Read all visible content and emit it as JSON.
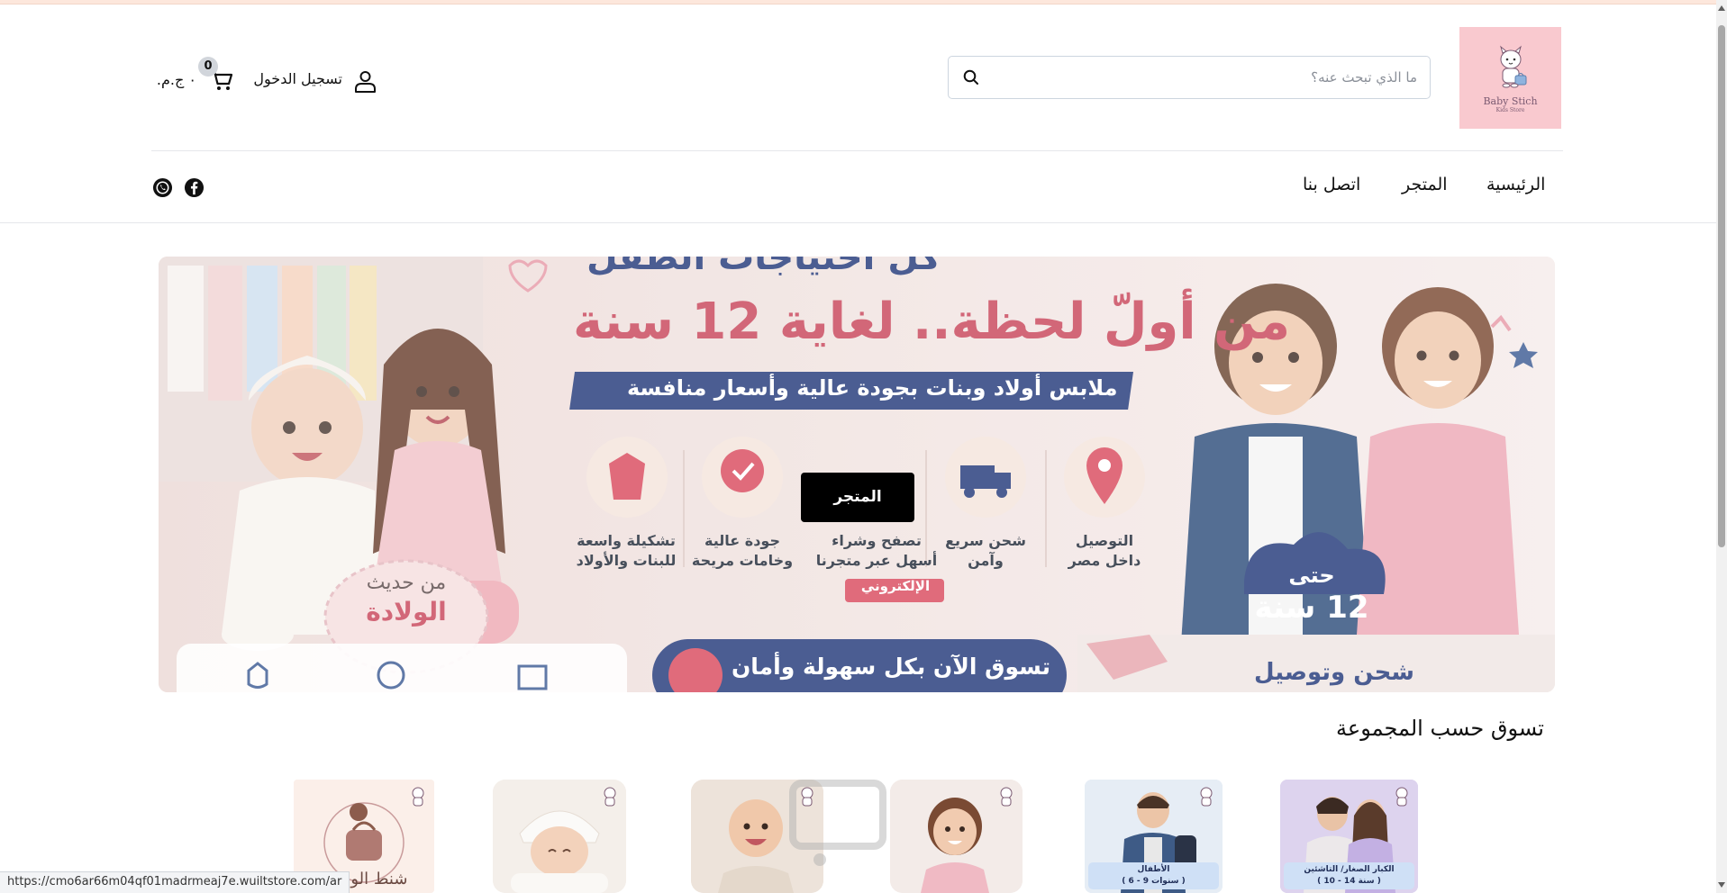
{
  "brand": {
    "logo_text": "Baby Stich",
    "logo_sub": "Kids Store"
  },
  "header": {
    "search_placeholder": "ما الذي تبحث عنه؟",
    "login_label": "تسجيل الدخول",
    "cart_count": "0",
    "cart_total": "٠ ج.م."
  },
  "nav": {
    "items": [
      {
        "label": "الرئيسية"
      },
      {
        "label": "المتجر"
      },
      {
        "label": "اتصل بنا"
      }
    ],
    "social": [
      "facebook-icon",
      "whatsapp-icon"
    ]
  },
  "hero": {
    "headline_top": "كل احتياجات الطفل",
    "headline": "من أولّ لحظة.. لغاية 12 سنة",
    "tagline": "ملابس أولاد وبنات بجودة عالية وأسعار منافسة",
    "features": [
      {
        "line1": "التوصيل",
        "line2": "داخل مصر"
      },
      {
        "line1": "شحن سريع",
        "line2": "وآمن"
      },
      {
        "line1": "تصفح وشراء",
        "line2": "أسهل عبر متجرنا"
      },
      {
        "line1": "جودة عالية",
        "line2": "وخامات مريحة"
      },
      {
        "line1": "تشكيلة واسعة",
        "line2": "للبنات والأولاد"
      }
    ],
    "online_badge": "الإلكتروني",
    "newborn_line1": "من حديث",
    "newborn_line2": "الولادة",
    "age_line1": "حتى",
    "age_line2": "12 سنة",
    "shop_now": "تسوق الآن بكل سهولة وأمان",
    "shipping": "شحن وتوصيل",
    "button_label": "المتجر"
  },
  "collections": {
    "title": "تسوق حسب المجموعة",
    "items": [
      {
        "label": "الكبار الصغار/ التاشئين",
        "sub": "( 10 - 14 سنة )"
      },
      {
        "label": "الأطفال",
        "sub": "( 6 - 9 سنوات )"
      },
      {
        "label": "",
        "sub": ""
      },
      {
        "label": "",
        "sub": ""
      },
      {
        "label": "",
        "sub": ""
      },
      {
        "label": "شنط الوامين",
        "sub": ""
      }
    ]
  },
  "status_bar": {
    "url": "https://cmo6ar66m04qf01madrmeaj7e.wuiltstore.com/ar"
  },
  "colors": {
    "accent_pink": "#f9c9cf",
    "navy": "#243a7a",
    "rose": "#c9465b",
    "button": "#000000"
  }
}
